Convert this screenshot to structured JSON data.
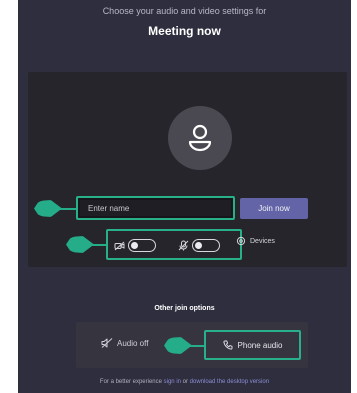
{
  "header": {
    "subtitle": "Choose your audio and video settings for",
    "title": "Meeting now"
  },
  "join": {
    "name_placeholder": "Enter name",
    "join_button": "Join now"
  },
  "devices": {
    "label": "Devices"
  },
  "other_options": {
    "heading": "Other join options",
    "audio_off": "Audio off",
    "phone_audio": "Phone audio"
  },
  "footer": {
    "prefix": "For a better experience",
    "sign_in": "sign in",
    "or": "or",
    "download": "download the desktop version"
  },
  "colors": {
    "background": "#2f2e3e",
    "preview": "#26252c",
    "accent_highlight": "#27b08a",
    "join_button": "#6264a7"
  },
  "icons": [
    "person-icon",
    "camera-off-icon",
    "mic-off-icon",
    "gear-icon",
    "speaker-off-icon",
    "phone-icon",
    "pointer-marker-icon"
  ],
  "toggles": {
    "camera_on": false,
    "mic_on": false
  }
}
